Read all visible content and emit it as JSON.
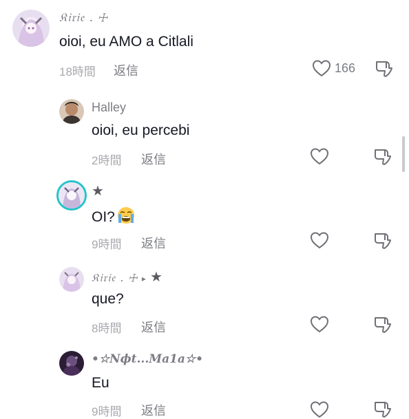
{
  "comments": [
    {
      "user": "𝔎𝔦𝔯𝔦𝔢 . ☩",
      "text": "oioi, eu AMO a Citlali",
      "time": "18時間",
      "reply": "返信",
      "likes": "166"
    },
    {
      "user": "Halley",
      "text": "oioi, eu percebi",
      "time": "2時間",
      "reply": "返信"
    },
    {
      "user": "★",
      "text": "OI?",
      "emoji": "loudly-crying-face",
      "time": "9時間",
      "reply": "返信"
    },
    {
      "user": "𝔎𝔦𝔯𝔦𝔢 . ☩",
      "reply_arrow": "▸",
      "reply_to": "★",
      "text": "que?",
      "time": "8時間",
      "reply": "返信"
    },
    {
      "user": "•☆𝑵𝝓𝒕...𝑴𝒂1𝒂☆•",
      "text": "Eu",
      "time": "9時間",
      "reply": "返信"
    }
  ],
  "colors": {
    "text": "#161823",
    "secondary": "#7c7d83",
    "meta": "#a8a9ae",
    "accent_ring": "#23c4c8"
  }
}
